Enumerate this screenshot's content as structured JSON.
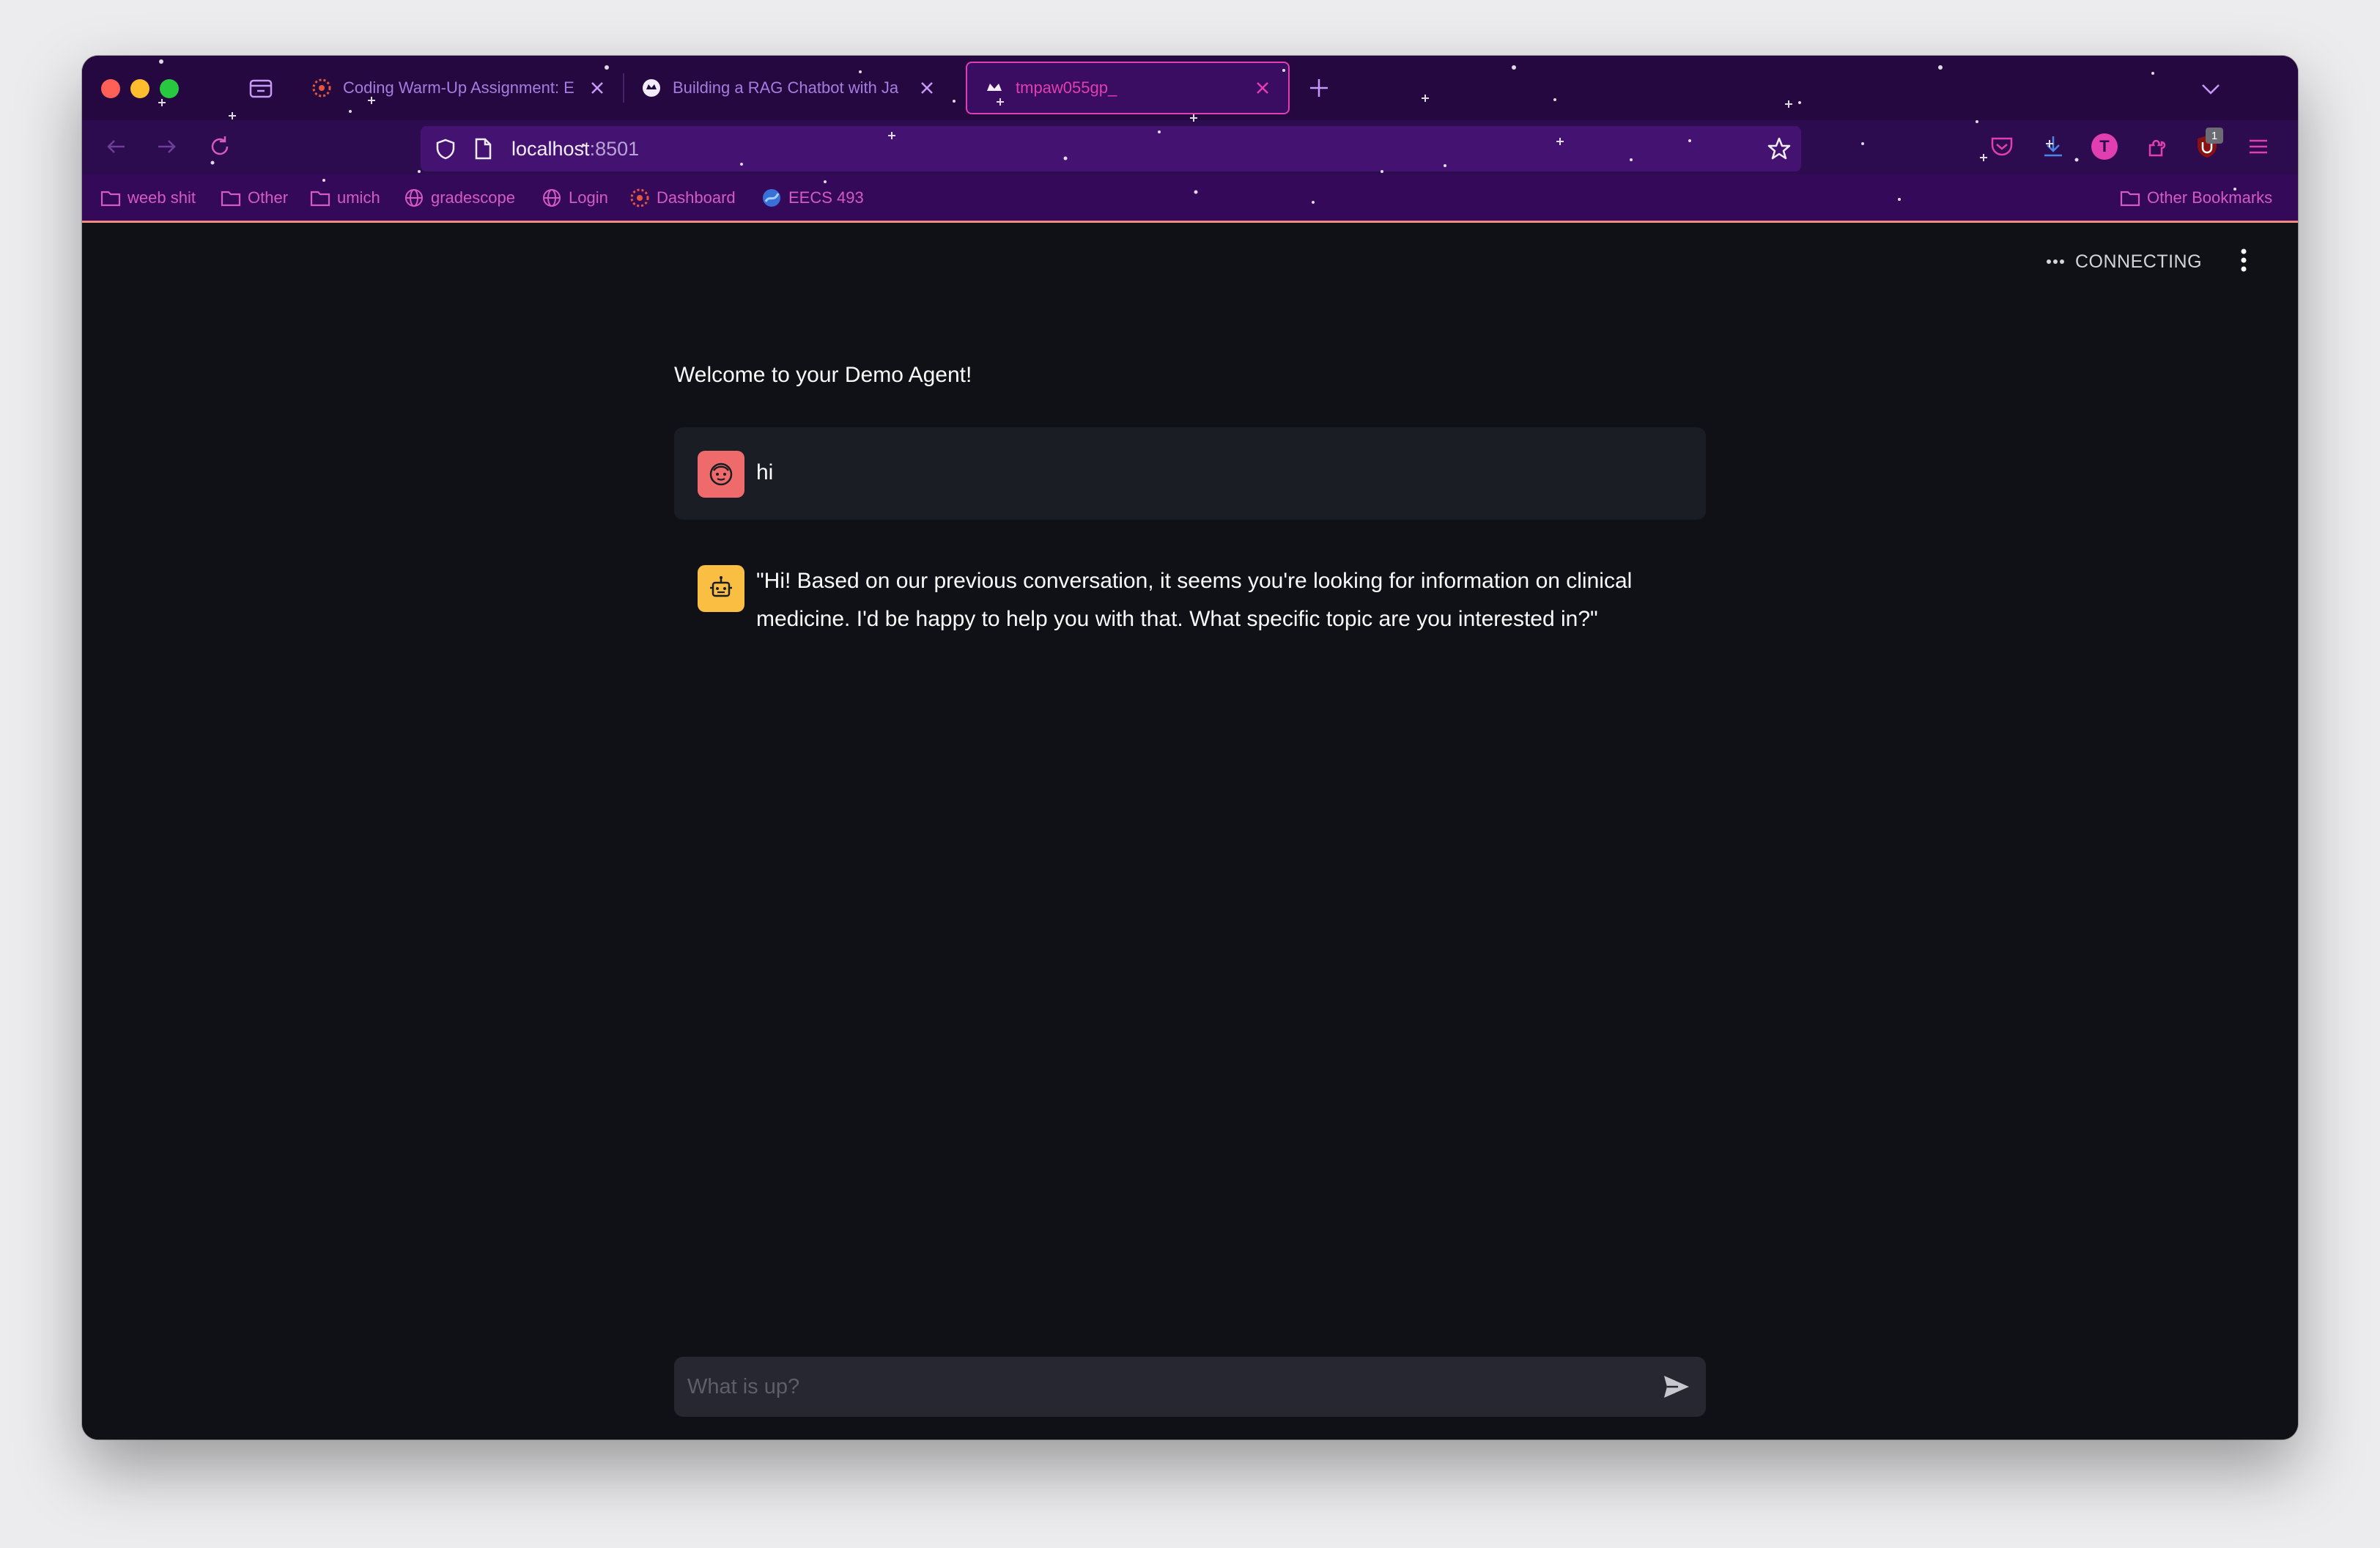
{
  "browser": {
    "tabs": [
      {
        "title": "Coding Warm-Up Assignment: E",
        "favicon": "canvas-icon",
        "active": false
      },
      {
        "title": "Building a RAG Chatbot with Ja",
        "favicon": "streamlit-icon",
        "active": false
      },
      {
        "title": "tmpaw055gp_",
        "favicon": "streamlit-icon",
        "active": true
      }
    ],
    "url": {
      "host": "localhost",
      "port": ":8501"
    },
    "toolbar_badge": "1",
    "account_initial": "T",
    "bookmarks": [
      {
        "label": "weeb shit",
        "icon": "folder-icon"
      },
      {
        "label": "Other",
        "icon": "folder-icon"
      },
      {
        "label": "umich",
        "icon": "folder-icon"
      },
      {
        "label": "gradescope",
        "icon": "globe-icon"
      },
      {
        "label": "Login",
        "icon": "globe-icon"
      },
      {
        "label": "Dashboard",
        "icon": "canvas-icon"
      },
      {
        "label": "EECS 493",
        "icon": "eecs-icon"
      }
    ],
    "other_bookmarks": "Other Bookmarks"
  },
  "app": {
    "status": "CONNECTING",
    "welcome": "Welcome to your Demo Agent!",
    "messages": [
      {
        "role": "user",
        "avatar": "user-face-icon",
        "text": "hi"
      },
      {
        "role": "assistant",
        "avatar": "robot-icon",
        "text": "\"Hi! Based on our previous conversation, it seems you're looking for information on clinical medicine. I'd be happy to help you with that. What specific topic are you interested in?\""
      }
    ],
    "chat_input": {
      "placeholder": "What is up?",
      "value": ""
    }
  },
  "colors": {
    "tabstrip": "#24083f",
    "navbar": "#2d0b4f",
    "accent": "#e13eb1",
    "content_bg": "#0f1116",
    "user_avatar": "#ef6a6a",
    "bot_avatar": "#fabe42"
  }
}
